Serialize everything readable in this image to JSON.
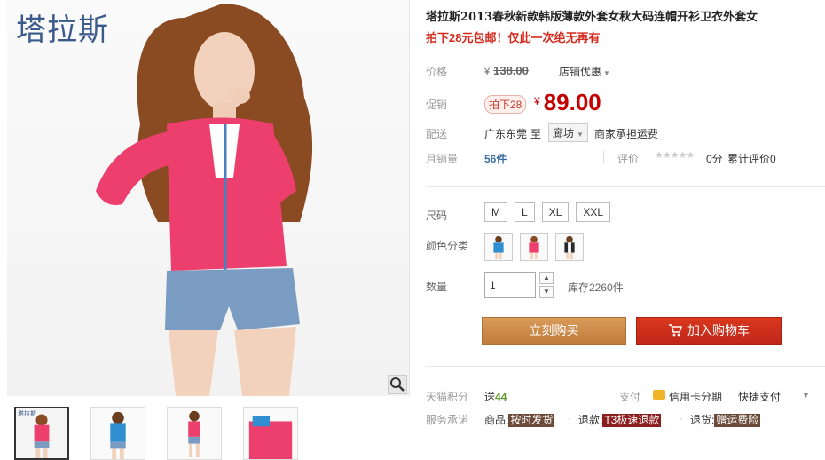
{
  "brand": {
    "logo_text": "塔拉斯"
  },
  "product": {
    "title": "塔拉斯2013春秋新款韩版薄款外套女秋大码连帽开衫卫衣外套女",
    "subtitle": "拍下28元包邮！仅此一次绝无再有"
  },
  "price": {
    "label": "价格",
    "currency": "¥",
    "original": "138.00",
    "shop_discount": "店铺优惠",
    "promo_label": "促销",
    "promo_tag": "拍下28",
    "promo_price": "89.00"
  },
  "shipping": {
    "label": "配送",
    "from": "广东东莞",
    "to": "至",
    "city": "廊坊",
    "note": "商家承担运费"
  },
  "sales": {
    "label": "月销量",
    "count": "56件",
    "review_label": "评价",
    "stars": "★★★★★",
    "score": "0分",
    "total": "累计评价0"
  },
  "options": {
    "size_label": "尺码",
    "sizes": [
      "M",
      "L",
      "XL",
      "XXL"
    ],
    "color_label": "颜色分类",
    "colors": [
      "blue-hoodie",
      "pink-hoodie",
      "black-hoodie"
    ]
  },
  "quantity": {
    "label": "数量",
    "value": "1",
    "stock": "库存2260件"
  },
  "actions": {
    "buy_now": "立刻购买",
    "add_cart": "加入购物车"
  },
  "tmall": {
    "points_label": "天猫积分",
    "points_prefix": "送",
    "points_value": "44",
    "pay_label": "支付",
    "card_pay": "信用卡分期",
    "quick_pay": "快捷支付"
  },
  "service": {
    "label": "服务承诺",
    "goods_label": "商品:",
    "goods_badge": "按时发货",
    "refund_label": "退款:",
    "refund_badge": "T3极速退款",
    "return_label": "退货:",
    "return_badge": "赠运费险"
  },
  "colors": {
    "accent_red": "#c40000",
    "buy_btn": "#c98d4d",
    "cart_btn": "#c0261a"
  }
}
